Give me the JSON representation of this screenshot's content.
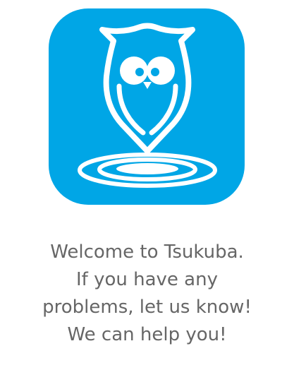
{
  "app_icon": {
    "icon": "owl-location-pin-icon",
    "background_color": "#00A6E6",
    "foreground_color": "#FFFFFF"
  },
  "welcome_message": {
    "lines": [
      "Welcome to Tsukuba.",
      "If you have any",
      "problems, let us know!",
      "We can help you!"
    ],
    "text_color": "#666666"
  }
}
